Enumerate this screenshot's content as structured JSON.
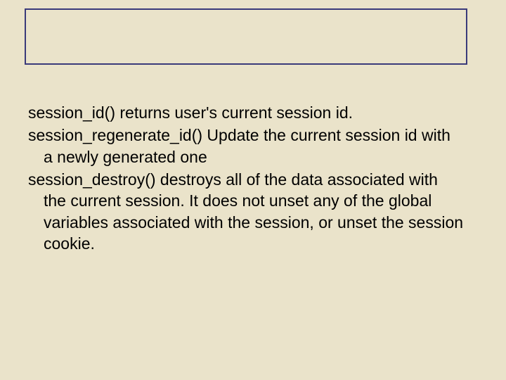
{
  "content": {
    "paragraphs": [
      "session_id() returns user's current session id.",
      "session_regenerate_id() Update the current session id with a newly generated one",
      "session_destroy() destroys all of the data associated with the current session. It does not unset any of the global variables associated with the session, or unset the session cookie."
    ]
  }
}
